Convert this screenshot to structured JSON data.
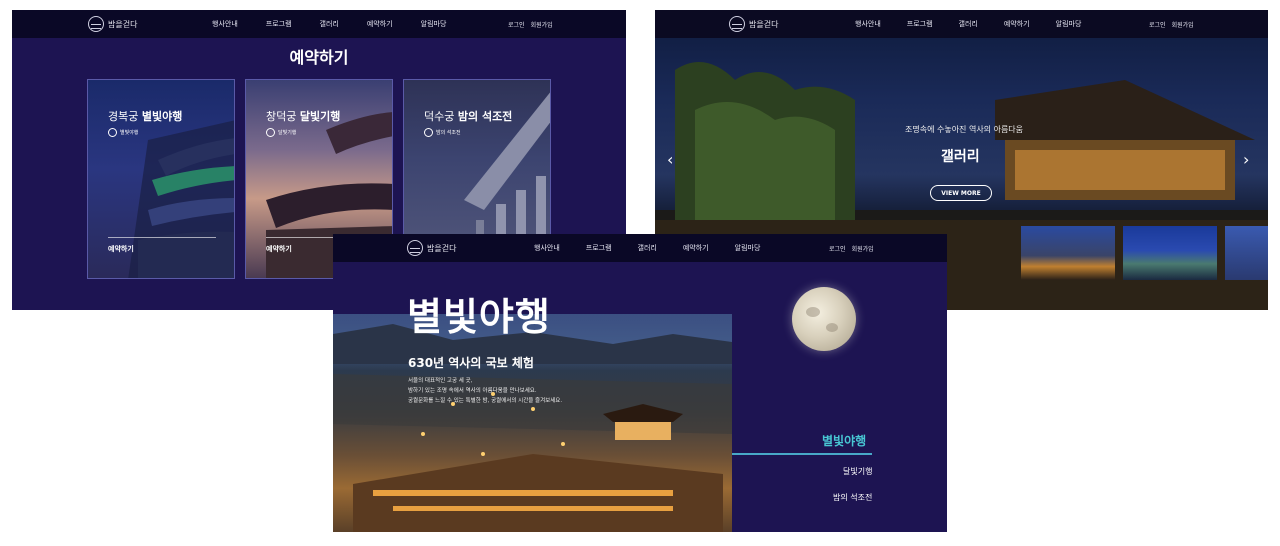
{
  "brand": {
    "logo_text": "밤을걷다"
  },
  "nav": {
    "items": [
      "행사안내",
      "프로그램",
      "갤러리",
      "예약하기",
      "알림마당"
    ],
    "login": "로그인",
    "signup": "회원가입"
  },
  "reservation": {
    "title": "예약하기",
    "cards": [
      {
        "prefix": "경복궁",
        "name": "별빛야행",
        "badge": "별빛야행",
        "action": "예약하기"
      },
      {
        "prefix": "창덕궁",
        "name": "달빛기행",
        "badge": "달빛기행",
        "action": "예약하기"
      },
      {
        "prefix": "덕수궁",
        "name": "밤의 석조전",
        "badge": "밤의 석조전",
        "action": ""
      }
    ]
  },
  "gallery": {
    "subtitle": "조명속에 수놓아진 역사의 아름다움",
    "title": "갤러리",
    "button": "VIEW MORE",
    "prev": "‹",
    "next": "›"
  },
  "program": {
    "headline": "별빛야행",
    "subtitle": "630년 역사의 국보 체험",
    "desc": [
      "서울의 대표적인 고궁 세 곳,",
      "밤하기 있는 조명 속에서 역사의 아름다움을 만나보세요.",
      "궁궐문화를 느낄 수 있는 특별한 밤, 궁궐에서의 시간을 즐겨보세요."
    ],
    "tabs": {
      "active": "별빛야행",
      "second": "달빛기행",
      "third": "밤의 석조전"
    }
  },
  "colors": {
    "bg_navy": "#1d1452",
    "nav_dark": "#0a0826",
    "accent_cyan": "#48c8d4"
  }
}
